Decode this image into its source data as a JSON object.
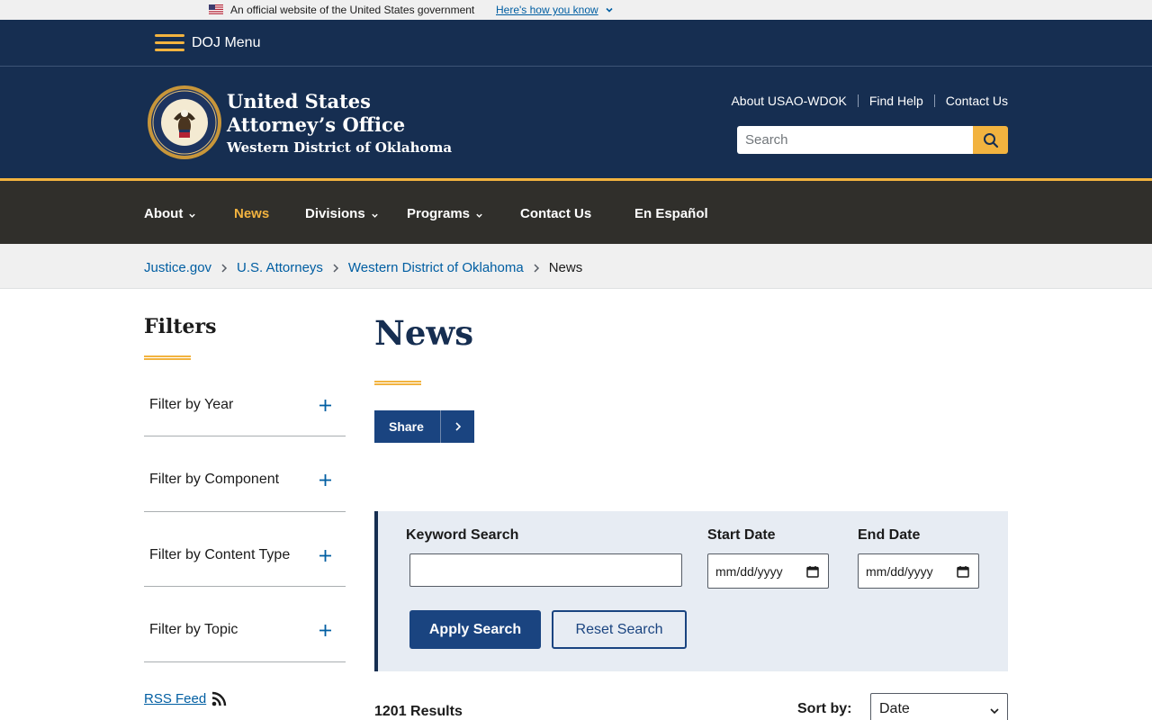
{
  "gov_banner": {
    "text": "An official website of the United States government",
    "how_link": "Here's how you know"
  },
  "doj_menu": {
    "label": "DOJ Menu"
  },
  "header": {
    "title_line1": "United States",
    "title_line2": "Attorney’s Office",
    "title_line3": "Western District of Oklahoma",
    "util_links": [
      "About USAO-WDOK",
      "Find Help",
      "Contact Us"
    ],
    "search_placeholder": "Search"
  },
  "nav": {
    "items": [
      {
        "label": "About",
        "dropdown": true
      },
      {
        "label": "News",
        "dropdown": false,
        "active": true
      },
      {
        "label": "Divisions",
        "dropdown": true
      },
      {
        "label": "Programs",
        "dropdown": true
      },
      {
        "label": "Contact Us",
        "dropdown": false
      },
      {
        "label": "En Español",
        "dropdown": false
      }
    ]
  },
  "breadcrumb": {
    "items": [
      "Justice.gov",
      "U.S. Attorneys",
      "Western District of Oklahoma"
    ],
    "current": "News"
  },
  "filters": {
    "title": "Filters",
    "items": [
      "Filter by Year",
      "Filter by Component",
      "Filter by Content Type",
      "Filter by Topic"
    ],
    "rss_label": "RSS Feed"
  },
  "main": {
    "title": "News",
    "share_label": "Share",
    "search_panel": {
      "keyword_label": "Keyword Search",
      "keyword_value": "",
      "start_label": "Start Date",
      "start_value": "mm/dd/yyyy",
      "end_label": "End Date",
      "end_value": "mm/dd/yyyy",
      "apply_label": "Apply Search",
      "reset_label": "Reset Search"
    },
    "results": "1201 Results",
    "sort_label": "Sort by:",
    "sort_value": "Date"
  },
  "colors": {
    "navy": "#162e51",
    "gold": "#f2b33f",
    "dark_nav": "#302f2b",
    "link_blue": "#005ea2",
    "button_blue": "#1a4480"
  }
}
